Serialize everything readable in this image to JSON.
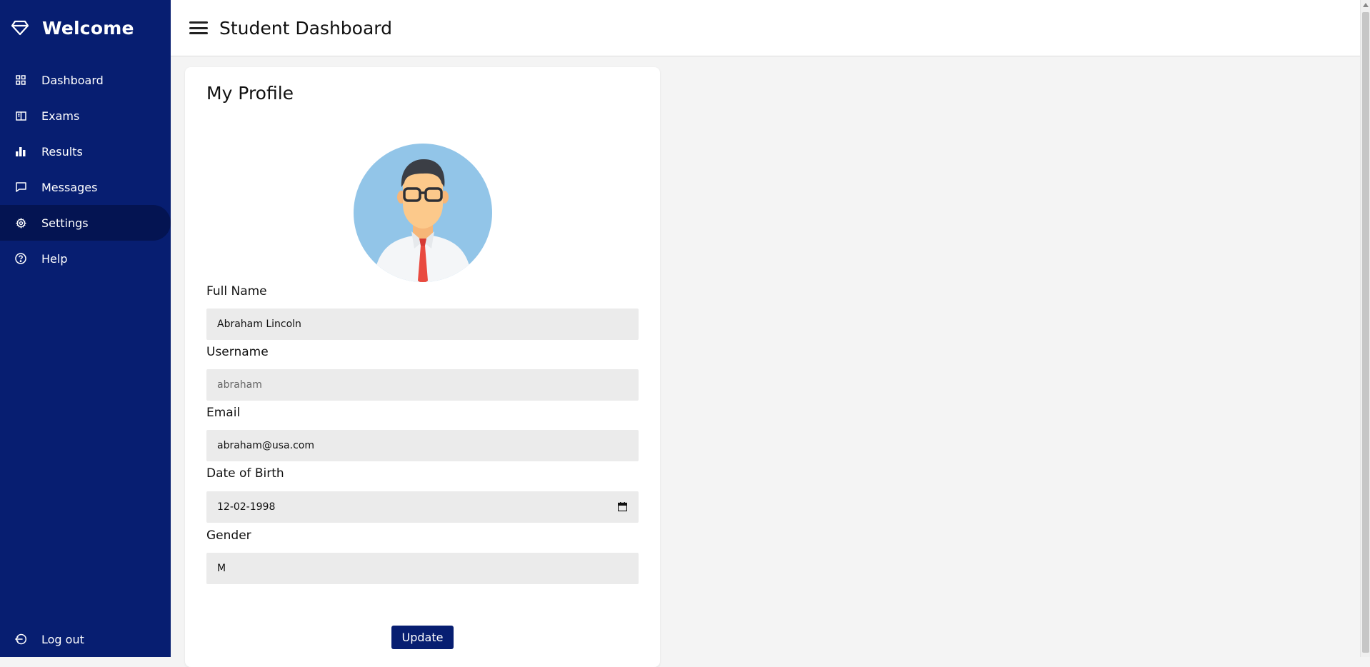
{
  "sidebar": {
    "brand": {
      "title": "Welcome",
      "icon": "diamond-icon"
    },
    "items": [
      {
        "label": "Dashboard",
        "icon": "grid-icon"
      },
      {
        "label": "Exams",
        "icon": "book-icon"
      },
      {
        "label": "Results",
        "icon": "bar-chart-icon"
      },
      {
        "label": "Messages",
        "icon": "chat-icon"
      },
      {
        "label": "Settings",
        "icon": "gear-icon",
        "active": true
      },
      {
        "label": "Help",
        "icon": "help-icon"
      }
    ],
    "logout": {
      "label": "Log out",
      "icon": "logout-icon"
    }
  },
  "topbar": {
    "title": "Student Dashboard",
    "menu_icon": "hamburger-icon"
  },
  "profile": {
    "title": "My Profile",
    "avatar": "user-avatar",
    "fields": {
      "full_name": {
        "label": "Full Name",
        "value": "Abraham Lincoln"
      },
      "username": {
        "label": "Username",
        "value": "abraham"
      },
      "email": {
        "label": "Email",
        "value": "abraham@usa.com"
      },
      "dob": {
        "label": "Date of Birth",
        "value": "12-02-1998"
      },
      "gender": {
        "label": "Gender",
        "value": "M"
      }
    },
    "update_label": "Update"
  },
  "colors": {
    "sidebar_bg": "#071e71",
    "sidebar_active_bg": "#041452",
    "page_bg": "#f4f4f4",
    "field_bg": "#ebebeb",
    "button_bg": "#071e71"
  }
}
